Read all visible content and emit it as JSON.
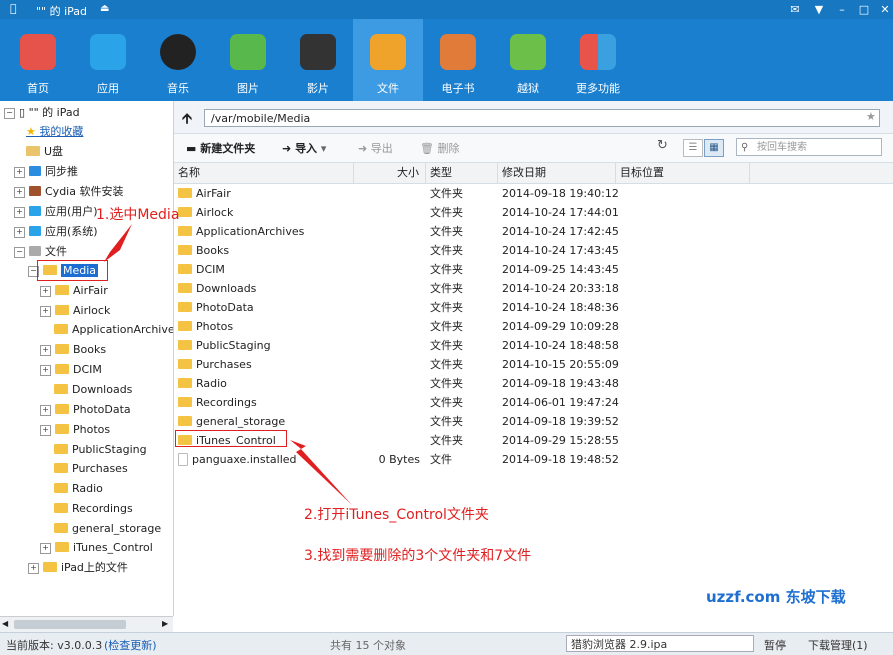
{
  "window": {
    "device_name": "\"\" 的 iPad"
  },
  "toolbar": {
    "items": [
      {
        "label": "首页",
        "color": "#e5534b"
      },
      {
        "label": "应用",
        "color": "#2ba3e8"
      },
      {
        "label": "音乐",
        "color": "#222222"
      },
      {
        "label": "图片",
        "color": "#58b84c"
      },
      {
        "label": "影片",
        "color": "#333333"
      },
      {
        "label": "文件",
        "color": "#f0a32a"
      },
      {
        "label": "电子书",
        "color": "#e07b39"
      },
      {
        "label": "越狱",
        "color": "#6cc04a"
      },
      {
        "label": "更多功能",
        "color": "#e8534a"
      }
    ],
    "active_index": 5
  },
  "tree": {
    "root": "\"\" 的 iPad",
    "top": [
      "我的收藏",
      "U盘",
      "同步推",
      "Cydia 软件安装",
      "应用(用户)",
      "应用(系统)",
      "文件"
    ],
    "media": "Media",
    "children": [
      "AirFair",
      "Airlock",
      "ApplicationArchives",
      "Books",
      "DCIM",
      "Downloads",
      "PhotoData",
      "Photos",
      "PublicStaging",
      "Purchases",
      "Radio",
      "Recordings",
      "general_storage",
      "iTunes_Control"
    ],
    "ipad_files": "iPad上的文件"
  },
  "address": {
    "path": "/var/mobile/Media"
  },
  "actions": {
    "new_folder": "新建文件夹",
    "import": "导入",
    "export": "导出",
    "delete": "删除",
    "search_placeholder": "按回车搜索"
  },
  "columns": {
    "name": "名称",
    "size": "大小",
    "type": "类型",
    "date": "修改日期",
    "target": "目标位置"
  },
  "rows": [
    {
      "name": "AirFair",
      "size": "",
      "type": "文件夹",
      "date": "2014-09-18 19:40:12"
    },
    {
      "name": "Airlock",
      "size": "",
      "type": "文件夹",
      "date": "2014-10-24 17:44:01"
    },
    {
      "name": "ApplicationArchives",
      "size": "",
      "type": "文件夹",
      "date": "2014-10-24 17:42:45"
    },
    {
      "name": "Books",
      "size": "",
      "type": "文件夹",
      "date": "2014-10-24 17:43:45"
    },
    {
      "name": "DCIM",
      "size": "",
      "type": "文件夹",
      "date": "2014-09-25 14:43:45"
    },
    {
      "name": "Downloads",
      "size": "",
      "type": "文件夹",
      "date": "2014-10-24 20:33:18"
    },
    {
      "name": "PhotoData",
      "size": "",
      "type": "文件夹",
      "date": "2014-10-24 18:48:36"
    },
    {
      "name": "Photos",
      "size": "",
      "type": "文件夹",
      "date": "2014-09-29 10:09:28"
    },
    {
      "name": "PublicStaging",
      "size": "",
      "type": "文件夹",
      "date": "2014-10-24 18:48:58"
    },
    {
      "name": "Purchases",
      "size": "",
      "type": "文件夹",
      "date": "2014-10-15 20:55:09"
    },
    {
      "name": "Radio",
      "size": "",
      "type": "文件夹",
      "date": "2014-09-18 19:43:48"
    },
    {
      "name": "Recordings",
      "size": "",
      "type": "文件夹",
      "date": "2014-06-01 19:47:24"
    },
    {
      "name": "general_storage",
      "size": "",
      "type": "文件夹",
      "date": "2014-09-18 19:39:52"
    },
    {
      "name": "iTunes_Control",
      "size": "",
      "type": "文件夹",
      "date": "2014-09-29 15:28:55"
    },
    {
      "name": "panguaxe.installed",
      "size": "0 Bytes",
      "type": "文件",
      "date": "2014-09-18 19:48:52"
    }
  ],
  "annotations": {
    "step1": "1.选中Media",
    "step2": "2.打开iTunes_Control文件夹",
    "step3": "3.找到需要删除的3个文件夹和7文件"
  },
  "status": {
    "version": "当前版本: v3.0.0.3",
    "check_update": "(检查更新)",
    "count": "共有 15 个对象",
    "browser": "猎豹浏览器  2.9.ipa",
    "pause": "暂停",
    "download_mgr": "下载管理(1)"
  },
  "watermark": "uzzf.com 东坡下载"
}
